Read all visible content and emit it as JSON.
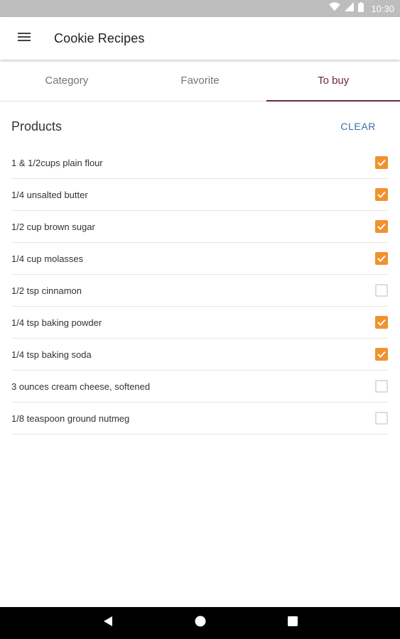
{
  "status_bar": {
    "time": "10:30",
    "icons": [
      "wifi-icon",
      "signal-icon",
      "battery-icon"
    ]
  },
  "app_bar": {
    "title": "Cookie Recipes",
    "menu_icon": "hamburger-menu-icon"
  },
  "tabs": [
    {
      "label": "Category",
      "active": false
    },
    {
      "label": "Favorite",
      "active": false
    },
    {
      "label": "To buy",
      "active": true
    }
  ],
  "products": {
    "title": "Products",
    "clear_label": "CLEAR",
    "items": [
      {
        "label": "1 & 1/2cups plain flour",
        "checked": true
      },
      {
        "label": "1/4 unsalted butter",
        "checked": true
      },
      {
        "label": "1/2 cup brown sugar",
        "checked": true
      },
      {
        "label": "1/4 cup molasses",
        "checked": true
      },
      {
        "label": "1/2 tsp cinnamon",
        "checked": false
      },
      {
        "label": "1/4 tsp baking powder",
        "checked": true
      },
      {
        "label": "1/4 tsp baking soda",
        "checked": true
      },
      {
        "label": "3 ounces cream cheese, softened",
        "checked": false
      },
      {
        "label": "1/8 teaspoon ground nutmeg",
        "checked": false
      }
    ]
  },
  "nav_bar": {
    "buttons": [
      "back-icon",
      "home-icon",
      "recents-icon"
    ]
  },
  "colors": {
    "accent": "#6b2a34",
    "checkbox_checked": "#f0922e",
    "clear_button": "#3a6fb0",
    "status_bar": "#bdbdbd"
  }
}
